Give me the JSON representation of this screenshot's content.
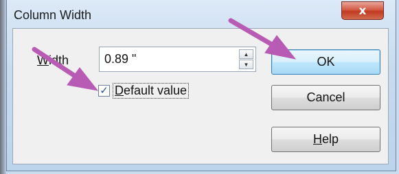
{
  "dialog": {
    "title": "Column Width",
    "close_glyph": "x",
    "width_label_first": "W",
    "width_label_rest": "idth",
    "width_value": "0.89 \"",
    "default_checkbox": {
      "checked": true,
      "check_glyph": "✓",
      "label_first": "D",
      "label_rest": "efault value"
    },
    "buttons": {
      "ok": "OK",
      "cancel": "Cancel",
      "help_first": "H",
      "help_rest": "elp"
    }
  },
  "annotation_color": "#b85bb4",
  "icons": [
    "close-icon",
    "spin-up-icon",
    "spin-down-icon",
    "checkmark-icon",
    "arrow-annotation"
  ]
}
